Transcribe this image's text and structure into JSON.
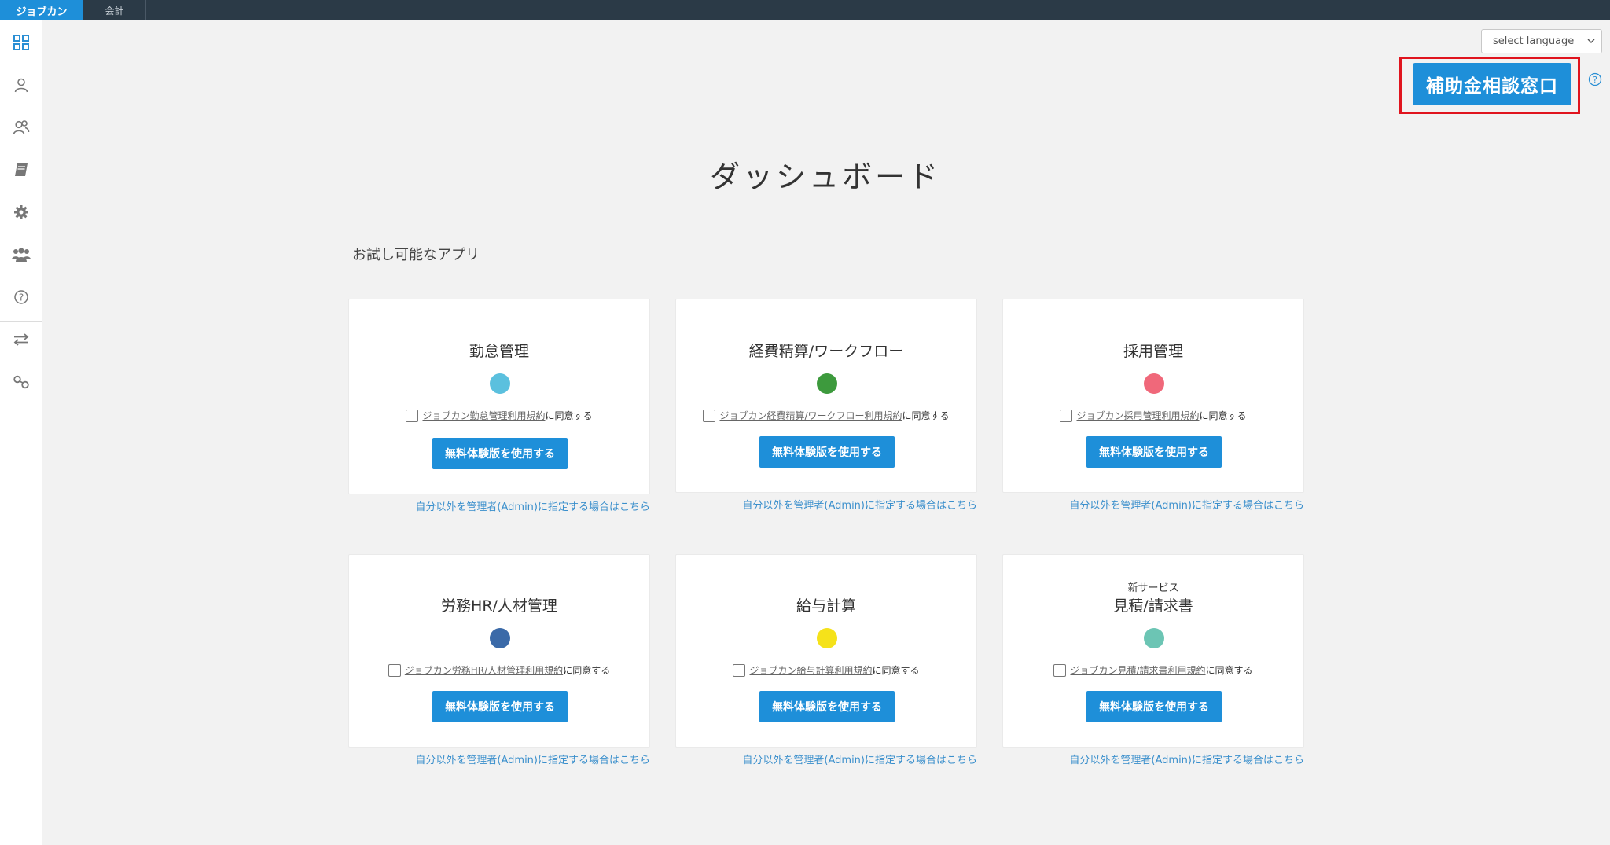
{
  "topbar": {
    "tabs": [
      {
        "label": "ジョブカン"
      },
      {
        "label": "会計"
      }
    ]
  },
  "sidebar": {
    "icons": [
      "dashboard-grid-icon",
      "user-icon",
      "users-icon",
      "book-icon",
      "gear-icon",
      "group-icon",
      "help-icon",
      "transfer-icon",
      "link-icon"
    ]
  },
  "header": {
    "language_select": "select language",
    "subsidy_button": "補助金相談窓口"
  },
  "main": {
    "title": "ダッシュボード",
    "section_label": "お試し可能なアプリ",
    "cards": [
      {
        "title": "勤怠管理",
        "badge": "",
        "color": "#5bc0de",
        "terms_link": "ジョブカン勤怠管理利用規約",
        "agree_suffix": "に同意する",
        "button": "無料体験版を使用する",
        "admin_link": "自分以外を管理者(Admin)に指定する場合はこちら"
      },
      {
        "title": "経費精算/ワークフロー",
        "badge": "",
        "color": "#3d9a3d",
        "terms_link": "ジョブカン経費精算/ワークフロー利用規約",
        "agree_suffix": "に同意する",
        "button": "無料体験版を使用する",
        "admin_link": "自分以外を管理者(Admin)に指定する場合はこちら"
      },
      {
        "title": "採用管理",
        "badge": "",
        "color": "#f0687a",
        "terms_link": "ジョブカン採用管理利用規約",
        "agree_suffix": "に同意する",
        "button": "無料体験版を使用する",
        "admin_link": "自分以外を管理者(Admin)に指定する場合はこちら"
      },
      {
        "title": "労務HR/人材管理",
        "badge": "",
        "color": "#3b6aa8",
        "terms_link": "ジョブカン労務HR/人材管理利用規約",
        "agree_suffix": "に同意する",
        "button": "無料体験版を使用する",
        "admin_link": "自分以外を管理者(Admin)に指定する場合はこちら"
      },
      {
        "title": "給与計算",
        "badge": "",
        "color": "#f5e21a",
        "terms_link": "ジョブカン給与計算利用規約",
        "agree_suffix": "に同意する",
        "button": "無料体験版を使用する",
        "admin_link": "自分以外を管理者(Admin)に指定する場合はこちら"
      },
      {
        "title": "見積/請求書",
        "badge": "新サービス",
        "color": "#6cc5b4",
        "terms_link": "ジョブカン見積/請求書利用規約",
        "agree_suffix": "に同意する",
        "button": "無料体験版を使用する",
        "admin_link": "自分以外を管理者(Admin)に指定する場合はこちら"
      }
    ]
  }
}
